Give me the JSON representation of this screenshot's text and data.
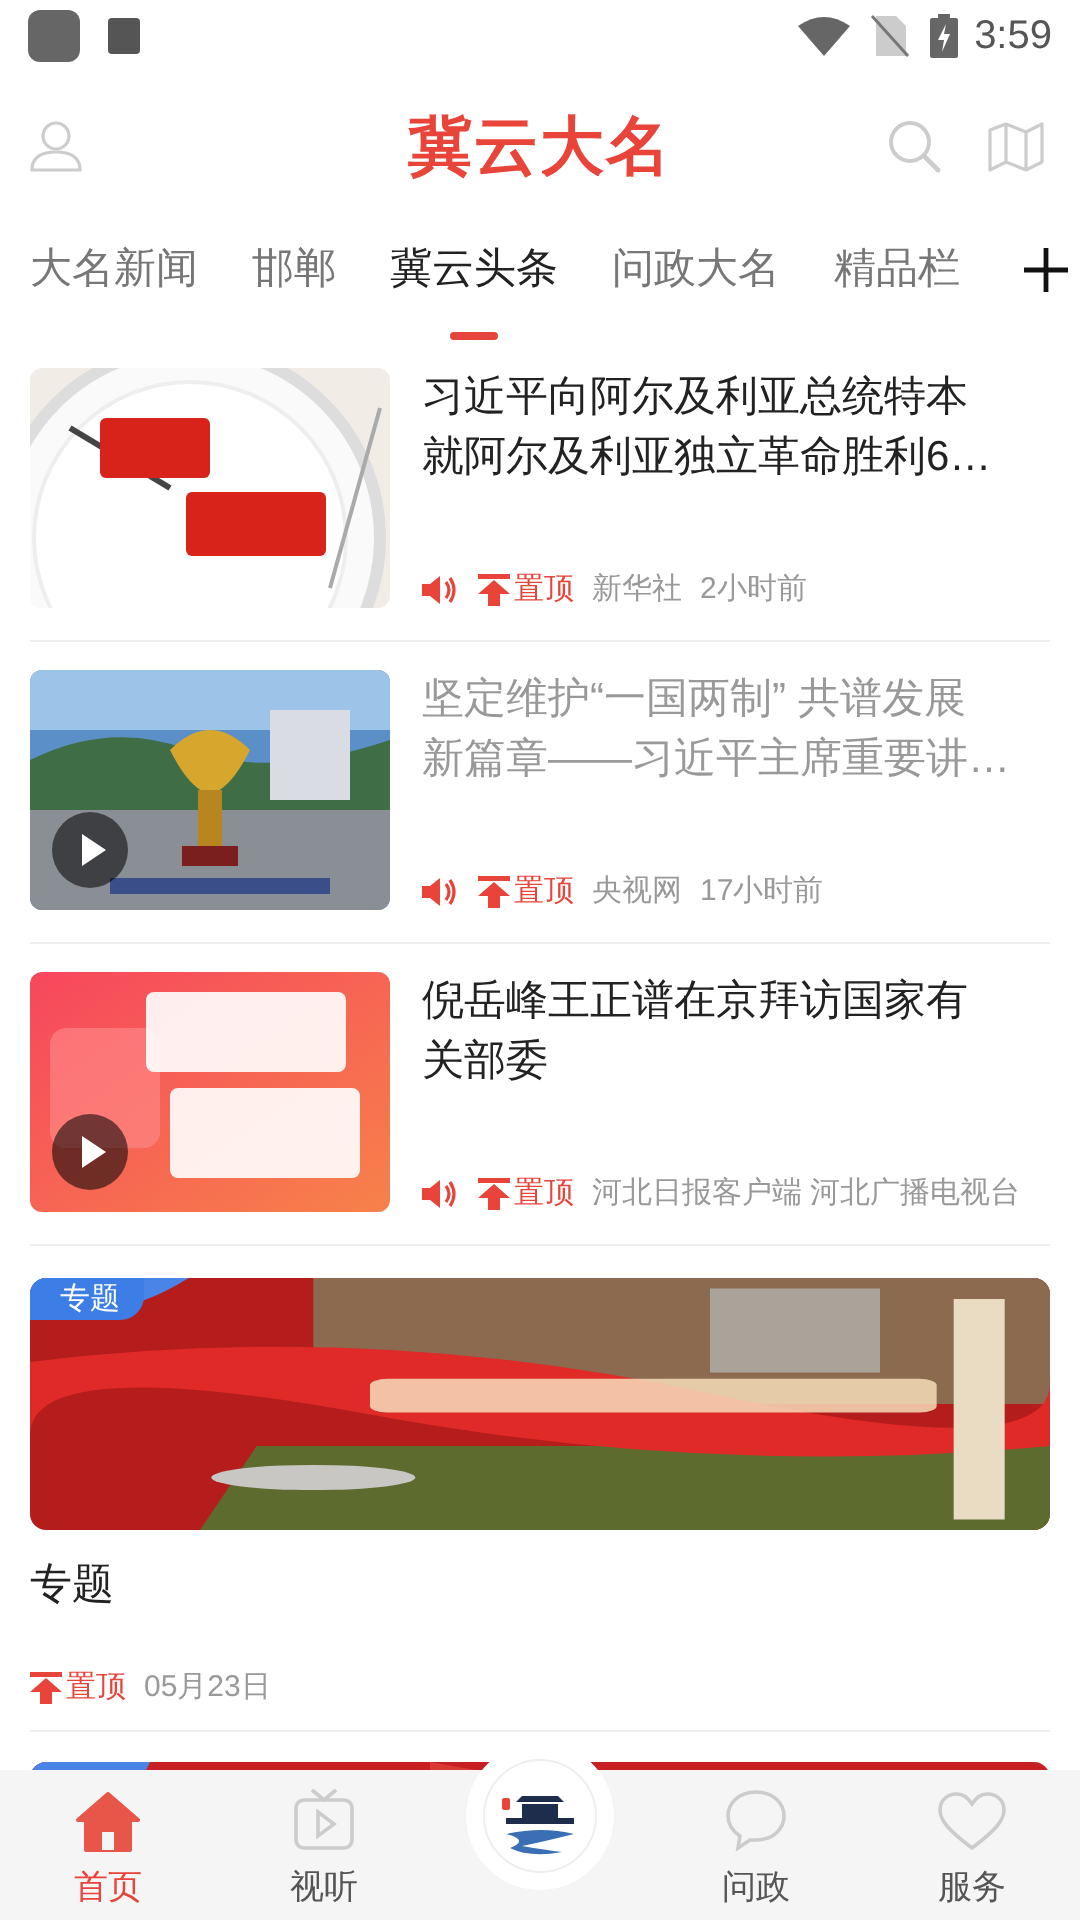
{
  "status_bar": {
    "time": "3:59"
  },
  "header": {
    "title": "冀云大名"
  },
  "tabs": [
    {
      "label": "大名新闻",
      "selected": false
    },
    {
      "label": "邯郸",
      "selected": false
    },
    {
      "label": "冀云头条",
      "selected": true
    },
    {
      "label": "问政大名",
      "selected": false
    },
    {
      "label": "精品栏",
      "selected": false
    }
  ],
  "articles": [
    {
      "title_lines": [
        "习近平向阿尔及利亚总统特本",
        "就阿尔及利亚独立革命胜利6…"
      ],
      "read": false,
      "video": false,
      "audio": true,
      "pinned": true,
      "pin_label": "置顶",
      "source": "新华社",
      "time": "2小时前"
    },
    {
      "title_lines": [
        "坚定维护“一国两制” 共谱发展",
        "新篇章——习近平主席重要讲…"
      ],
      "read": true,
      "video": true,
      "audio": true,
      "pinned": true,
      "pin_label": "置顶",
      "source": "央视网",
      "time": "17小时前"
    },
    {
      "title_lines": [
        "倪岳峰王正谱在京拜访国家有",
        "关部委"
      ],
      "read": false,
      "video": true,
      "audio": true,
      "pinned": true,
      "pin_label": "置顶",
      "source": "河北日报客户端 河北广播电视台"
    }
  ],
  "special": {
    "badge": "专题",
    "title": "专题",
    "pinned": true,
    "pin_label": "置顶",
    "date": "05月23日"
  },
  "bottom_nav": [
    {
      "kind": "tab",
      "label": "首页",
      "selected": true
    },
    {
      "kind": "tab",
      "label": "视听",
      "selected": false
    },
    {
      "kind": "logo"
    },
    {
      "kind": "tab",
      "label": "问政",
      "selected": false
    },
    {
      "kind": "tab",
      "label": "服务",
      "selected": false
    }
  ]
}
